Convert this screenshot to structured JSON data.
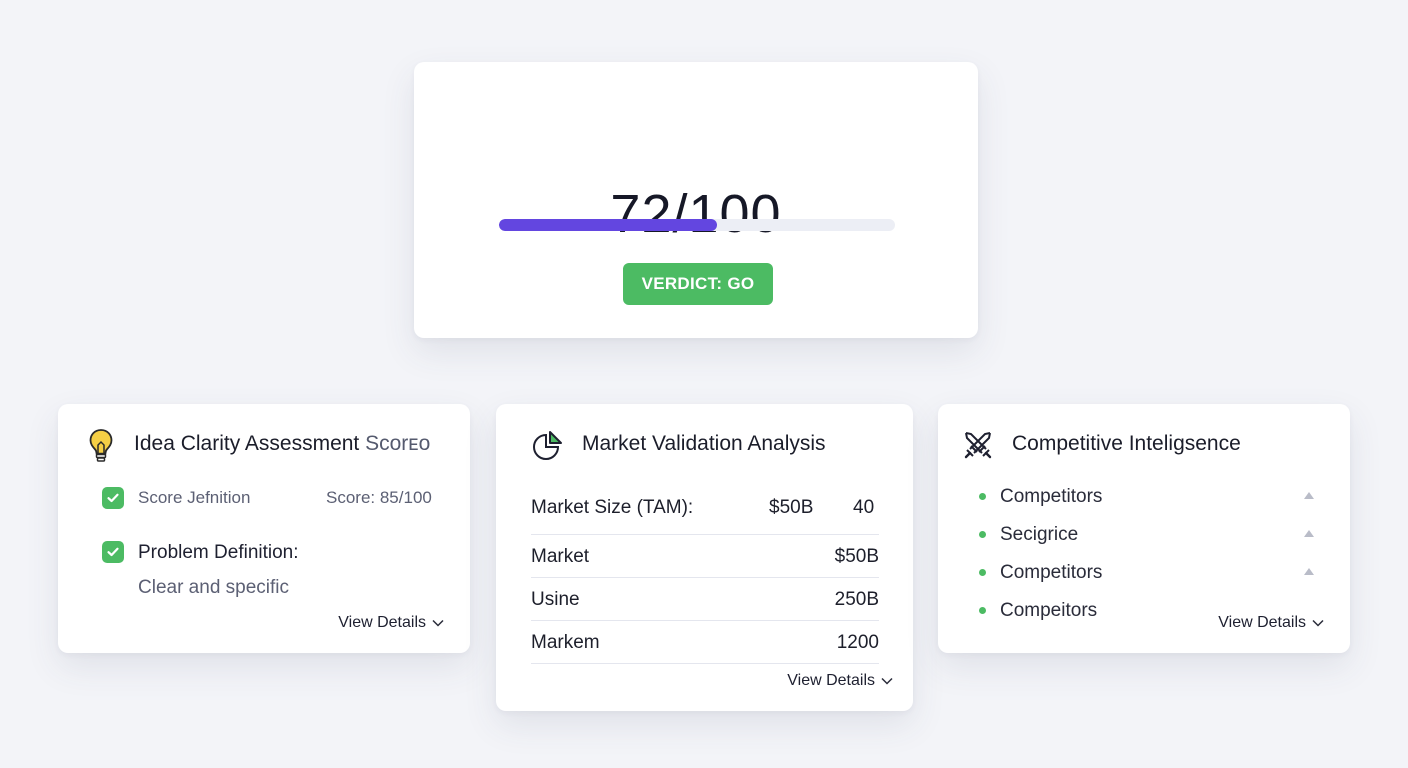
{
  "score": {
    "value": "72/100",
    "progress_percent": 55,
    "verdict": "VERDICT: GO",
    "progress_color": "#6346e0",
    "verdict_color": "#4cbb63"
  },
  "idea": {
    "icon": "lightbulb-icon",
    "title": "Idea Clarity Assessment",
    "title_suffix": "Scorᴇᴏ",
    "items": [
      {
        "label": "Score Jefnition",
        "score": "Score: 85/100"
      },
      {
        "label": "Problem Definition:",
        "detail": "Clear and specific"
      }
    ],
    "view_details": "View Details"
  },
  "market": {
    "icon": "pie-chart-icon",
    "title": "Market Validation Analysis",
    "header_row": {
      "label": "Market Size (TAM):",
      "value": "$50B",
      "extra": "40"
    },
    "rows": [
      {
        "label": "Market",
        "value": "$50B"
      },
      {
        "label": "Usine",
        "value": "250B"
      },
      {
        "label": "Markem",
        "value": "1200"
      }
    ],
    "view_details": "View Details"
  },
  "competitive": {
    "icon": "crossed-swords-icon",
    "title": "Competitive Inteligsence",
    "items": [
      {
        "label": "Competitors",
        "has_caret": true
      },
      {
        "label": "Secigrice",
        "has_caret": true
      },
      {
        "label": "Competitors",
        "has_caret": true
      },
      {
        "label": "Compeitors",
        "has_caret": false
      }
    ],
    "view_details": "View Details"
  }
}
